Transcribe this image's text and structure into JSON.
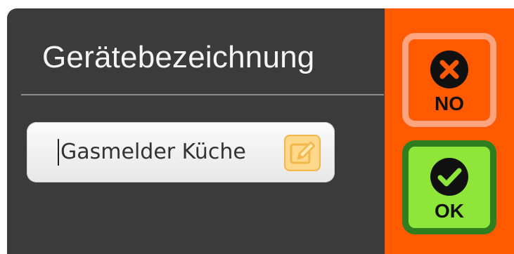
{
  "dialog": {
    "title": "Gerätebezeichnung",
    "name_field": {
      "value": "Gasmelder Küche",
      "edit_icon": "edit-pencil-icon"
    }
  },
  "actions": {
    "no": {
      "label": "NO",
      "icon": "close-icon"
    },
    "ok": {
      "label": "OK",
      "icon": "check-icon"
    }
  },
  "colors": {
    "dialog_background": "#3b3b3b",
    "accent": "#ff5a00",
    "no_border": "#ffa47f",
    "ok_fill": "#8ee63a",
    "ok_border": "#2e7d1e"
  }
}
